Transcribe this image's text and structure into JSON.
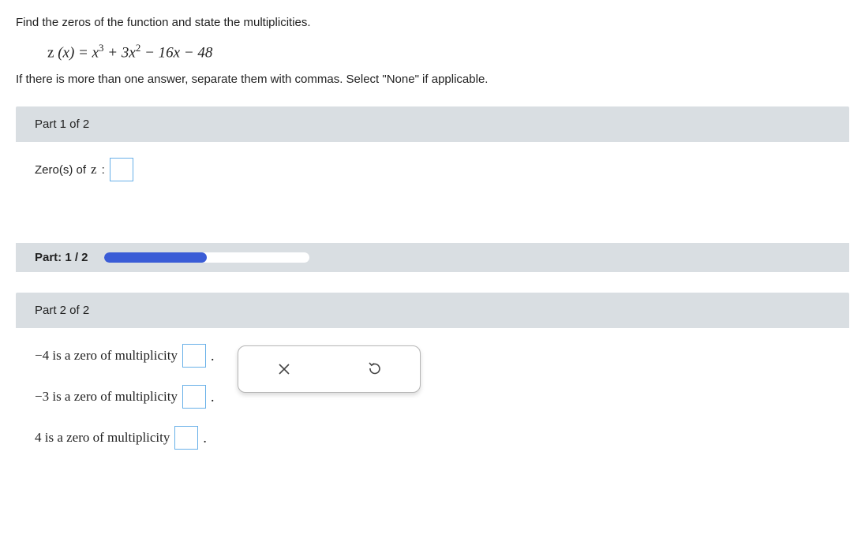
{
  "question": {
    "prompt": "Find the zeros of the function and state the multiplicities.",
    "instruction": "If there is more than one answer, separate them with commas. Select \"None\" if applicable."
  },
  "formula": {
    "fn": "z",
    "var": "x",
    "expr_plain": "= x³ + 3x² − 16x − 48"
  },
  "parts": {
    "p1": {
      "header": "Part 1 of 2",
      "label_prefix": "Zero(s) of ",
      "label_fn": "z",
      "label_suffix": ":"
    },
    "progress": {
      "label": "Part: 1 / 2",
      "percent": 50
    },
    "p2": {
      "header": "Part 2 of 2",
      "rows": [
        {
          "value": "−4",
          "text": " is a zero of multiplicity "
        },
        {
          "value": "−3",
          "text": " is a zero of multiplicity "
        },
        {
          "value": "4",
          "text": " is a zero of multiplicity "
        }
      ]
    }
  },
  "toolbox": {
    "clear": "×",
    "reset": "↺"
  }
}
